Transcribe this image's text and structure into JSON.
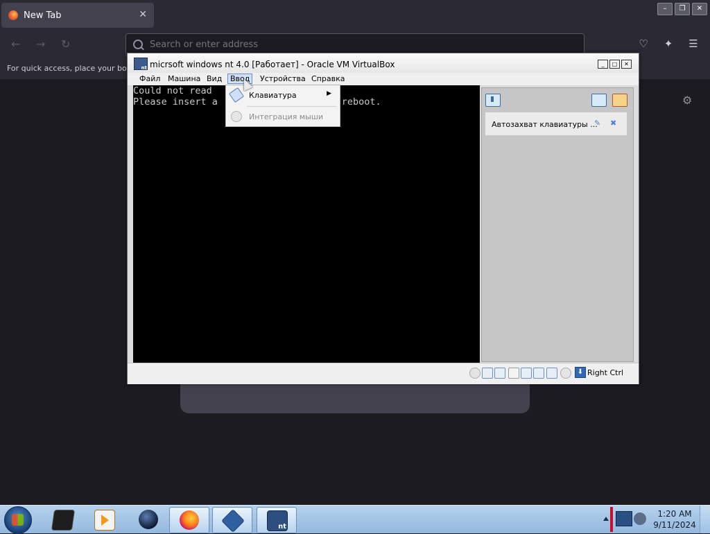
{
  "browser": {
    "tab_title": "New Tab",
    "tab_close": "✕",
    "window_controls": [
      "–",
      "❐",
      "✕"
    ],
    "nav": {
      "back": "←",
      "forward": "→",
      "reload": "↻"
    },
    "url_placeholder": "Search or enter address",
    "bookmarks_hint": "For quick access, place your boo",
    "right_icons": [
      "pocket-icon",
      "extensions-icon",
      "menu-icon"
    ],
    "settings_icon": "⚙"
  },
  "vbox": {
    "title": "micrsoft windows nt 4.0 [Работает] - Oracle VM VirtualBox",
    "controls": [
      "_",
      "□",
      "✕"
    ],
    "menu": [
      "Файл",
      "Машина",
      "Вид",
      "Ввод",
      "Устройства",
      "Справка"
    ],
    "active_menu_index": 3,
    "screen_lines": [
      "Could not read                    um!",
      "Please insert a                   nd reboot."
    ],
    "dropdown": [
      {
        "label": "Клавиатура",
        "has_submenu": true,
        "enabled": true
      },
      {
        "label": "Интеграция мыши",
        "has_submenu": false,
        "enabled": false
      }
    ],
    "notification": "Автозахват клавиатуры ...",
    "host_key": "Right Ctrl"
  },
  "taskbar": {
    "pinned": [
      "explorer-icon",
      "media-player-icon",
      "globe-icon",
      "firefox-icon",
      "virtualbox-icon",
      "nt-vm-icon"
    ],
    "clock_time": "1:20 AM",
    "clock_date": "9/11/2024"
  },
  "colors": {
    "firefox_bg": "#1c1b22",
    "taskbar": "#a9c8e8",
    "vm_screen": "#000000",
    "vm_text": "#c8c8c8"
  }
}
